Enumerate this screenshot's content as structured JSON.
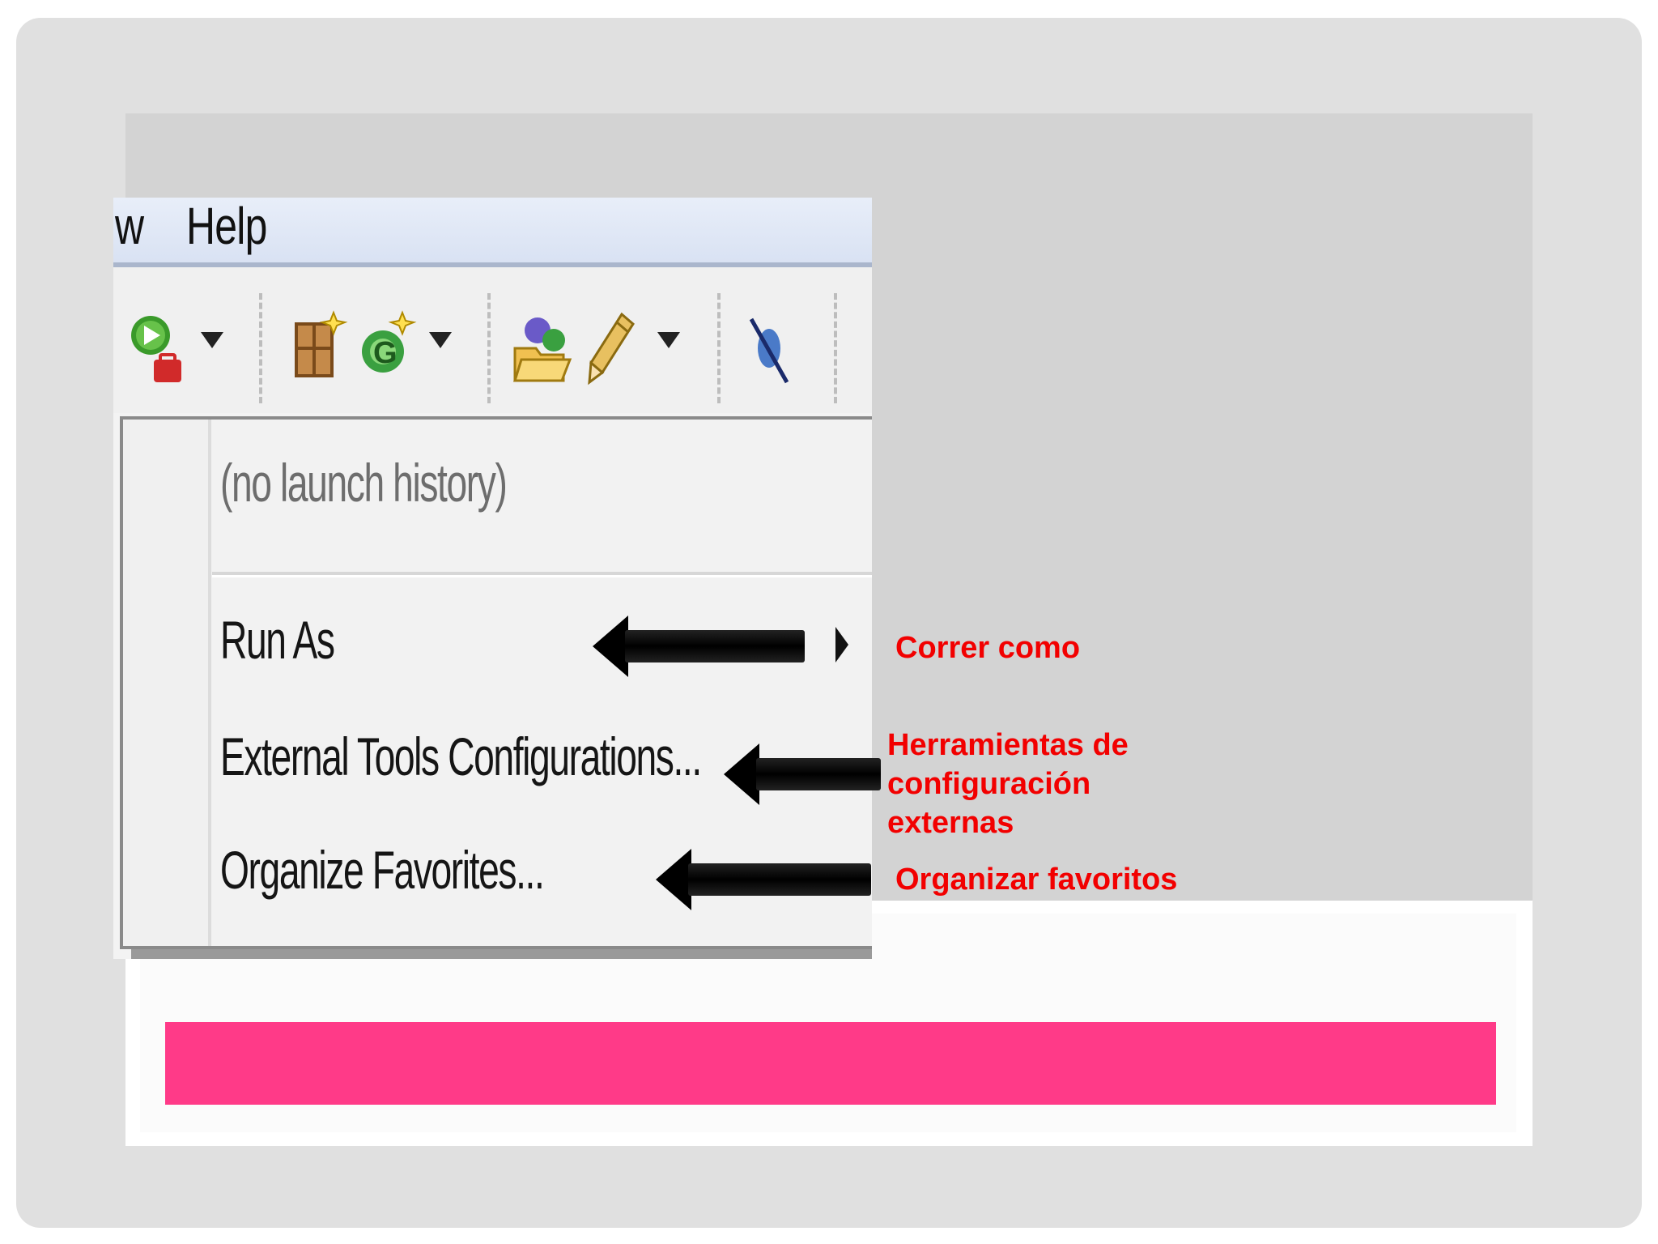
{
  "menubar": {
    "partial_label": "w",
    "help_label": "Help"
  },
  "toolbar": {
    "icons": [
      "run-icon",
      "new-class-icon",
      "new-interface-icon",
      "open-folder-icon",
      "pencil-icon",
      "skip-breakpoints-icon"
    ]
  },
  "dropdown": {
    "no_history": "(no launch history)",
    "run_as": "Run As",
    "external_tools": "External Tools Configurations...",
    "organize_favorites": "Organize Favorites..."
  },
  "annotations": {
    "run_as": "Correr como",
    "external_tools_line1": "Herramientas de",
    "external_tools_line2": "configuración",
    "external_tools_line3": "externas",
    "organize_favorites": "Organizar favoritos"
  },
  "colors": {
    "annotation": "#f20000",
    "accent_bar": "#ff3a88",
    "slide_bg": "#e0e0e0",
    "panel": "#d3d3d3"
  }
}
